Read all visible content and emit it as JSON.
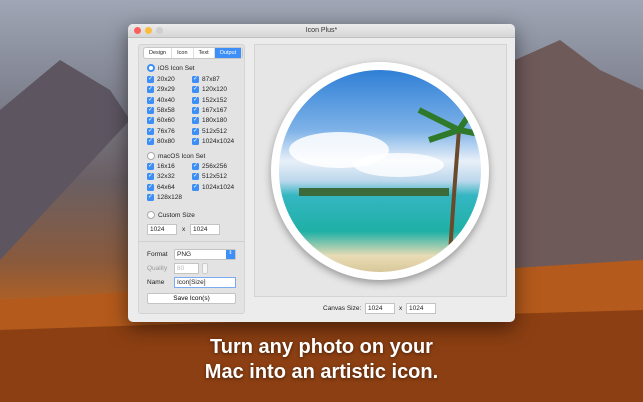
{
  "window": {
    "title": "Icon Plus*"
  },
  "tabs": [
    "Design",
    "Icon",
    "Text",
    "Output"
  ],
  "ios": {
    "label": "iOS Icon Set",
    "left": [
      "20x20",
      "29x29",
      "40x40",
      "58x58",
      "60x60",
      "76x76",
      "80x80"
    ],
    "right": [
      "87x87",
      "120x120",
      "152x152",
      "167x167",
      "180x180",
      "512x512",
      "1024x1024"
    ]
  },
  "macos": {
    "label": "macOS Icon Set",
    "left": [
      "16x16",
      "32x32",
      "64x64",
      "128x128"
    ],
    "right": [
      "256x256",
      "512x512",
      "1024x1024"
    ]
  },
  "custom": {
    "label": "Custom Size",
    "width": "1024",
    "x": "x",
    "height": "1024"
  },
  "format": {
    "label": "Format",
    "value": "PNG"
  },
  "quality": {
    "label": "Quality",
    "value": "80"
  },
  "name": {
    "label": "Name",
    "value": "Icon[Size]"
  },
  "save_label": "Save Icon(s)",
  "canvas": {
    "label": "Canvas Size:",
    "width": "1024",
    "x": "x",
    "height": "1024"
  },
  "caption": {
    "line1": "Turn any photo on your",
    "line2": "Mac into an artistic icon."
  }
}
